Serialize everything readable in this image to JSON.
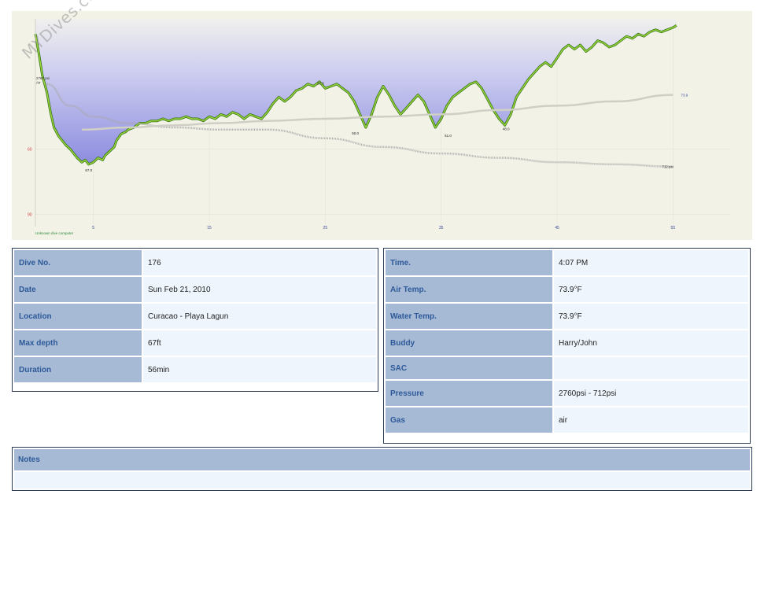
{
  "watermark": "MYDives.com",
  "chart_data": {
    "type": "area",
    "title": "",
    "computer_label": "Unknown dive computer",
    "xlim": [
      0,
      60
    ],
    "ylim": [
      100,
      0
    ],
    "x_ticks": [
      5,
      15,
      25,
      35,
      45,
      55
    ],
    "y_ticks": [
      60,
      90
    ],
    "start_pressure_label": "2760 psi",
    "gas_label": "Air",
    "end_pressure_label": "712 psi",
    "temp_label": "73.9",
    "depth_annotations": [
      {
        "x": 4.6,
        "y": 67,
        "label": "67.0"
      },
      {
        "x": 24.6,
        "y": 27,
        "label": "27.0"
      },
      {
        "x": 27.6,
        "y": 50,
        "label": "50.0"
      },
      {
        "x": 35.6,
        "y": 51,
        "label": "51.0"
      },
      {
        "x": 40.6,
        "y": 48,
        "label": "48.0"
      }
    ],
    "series": [
      {
        "values_x": [
          0,
          0.3,
          0.6,
          1,
          1.3,
          1.6,
          2,
          2.3,
          2.6,
          3,
          3.3,
          3.6,
          4,
          4.3,
          4.6,
          5,
          5.4,
          5.8,
          6,
          6.4,
          6.8,
          7,
          7.4,
          7.8,
          8,
          8.5,
          9,
          9.5,
          10,
          10.5,
          11,
          11.5,
          12,
          12.5,
          13,
          13.5,
          14,
          14.5,
          15,
          15.5,
          16,
          16.5,
          17,
          17.5,
          18,
          18.5,
          19,
          19.5,
          20,
          20.5,
          21,
          21.5,
          22,
          22.5,
          23,
          23.5,
          24,
          24.5,
          25,
          25.5,
          26,
          26.5,
          27,
          27.5,
          28,
          28.5,
          29,
          29.5,
          30,
          30.5,
          31,
          31.5,
          32,
          32.5,
          33,
          33.5,
          34,
          34.5,
          35,
          35.5,
          36,
          36.5,
          37,
          37.5,
          38,
          38.5,
          39,
          39.5,
          40,
          40.5,
          41,
          41.5,
          42,
          42.5,
          43,
          43.5,
          44,
          44.5,
          45,
          45.5,
          46,
          46.5,
          47,
          47.5,
          48,
          48.5,
          49,
          49.5,
          50,
          50.5,
          51,
          51.5,
          52,
          52.5,
          53,
          53.5,
          54,
          54.5,
          55,
          55.3
        ],
        "values_y": [
          7,
          16,
          26,
          34,
          43,
          50,
          54,
          56,
          58,
          60,
          62,
          64,
          66,
          65,
          67,
          66,
          64,
          65,
          63,
          61,
          59,
          56,
          53,
          52,
          51,
          50,
          48,
          48,
          47,
          47,
          46,
          47,
          46,
          46,
          45,
          46,
          46,
          47,
          45,
          46,
          44,
          45,
          43,
          44,
          46,
          44,
          45,
          46,
          43,
          39,
          36,
          38,
          36,
          33,
          32,
          30,
          31,
          29,
          32,
          31,
          30,
          32,
          34,
          38,
          44,
          50,
          44,
          36,
          31,
          35,
          40,
          44,
          41,
          38,
          35,
          38,
          44,
          50,
          46,
          40,
          36,
          34,
          32,
          30,
          29,
          32,
          37,
          42,
          46,
          49,
          44,
          36,
          32,
          28,
          25,
          22,
          20,
          22,
          18,
          14,
          12,
          14,
          12,
          15,
          13,
          10,
          11,
          13,
          12,
          10,
          8,
          9,
          7,
          8,
          6,
          5,
          6,
          5,
          4,
          3,
          2,
          0
        ]
      },
      {
        "name": "pressure",
        "values_x": [
          1,
          3,
          5,
          8,
          12,
          16,
          20,
          25,
          30,
          35,
          40,
          45,
          50,
          55
        ],
        "values_y": [
          30,
          40,
          45,
          48,
          50,
          51,
          51,
          55,
          59,
          62,
          64,
          66,
          67,
          68
        ]
      },
      {
        "name": "temperature",
        "values_x": [
          4,
          8,
          12,
          16,
          20,
          25,
          30,
          35,
          40,
          45,
          50,
          55
        ],
        "values_y": [
          51,
          50,
          49,
          48,
          47,
          46,
          45,
          44,
          42,
          40,
          38,
          35
        ]
      }
    ]
  },
  "dive_info": {
    "rows": [
      {
        "label": "Dive No.",
        "value": "176"
      },
      {
        "label": "Date",
        "value": "Sun Feb 21, 2010"
      },
      {
        "label": "Location",
        "value": "Curacao - Playa Lagun"
      },
      {
        "label": "Max depth",
        "value": "67ft"
      },
      {
        "label": "Duration",
        "value": "56min"
      }
    ]
  },
  "conditions": {
    "rows": [
      {
        "label": "Time.",
        "value": "4:07 PM"
      },
      {
        "label": "Air Temp.",
        "value": "73.9°F"
      },
      {
        "label": "Water Temp.",
        "value": "73.9°F"
      },
      {
        "label": "Buddy",
        "value": "Harry/John"
      },
      {
        "label": "SAC",
        "value": ""
      },
      {
        "label": "Pressure",
        "value": "2760psi - 712psi"
      },
      {
        "label": "Gas",
        "value": "air"
      }
    ]
  },
  "notes": {
    "label": "Notes",
    "text": ""
  },
  "colors": {
    "chart_bg": "#f2f2e7",
    "depth_fill_top": "#c5c5ef",
    "depth_line": "#2e6e10",
    "depth_line_light": "#9ad53c",
    "label_bg": "#a6b9d5",
    "label_text": "#2d5a99",
    "value_bg": "#eef5fd"
  }
}
